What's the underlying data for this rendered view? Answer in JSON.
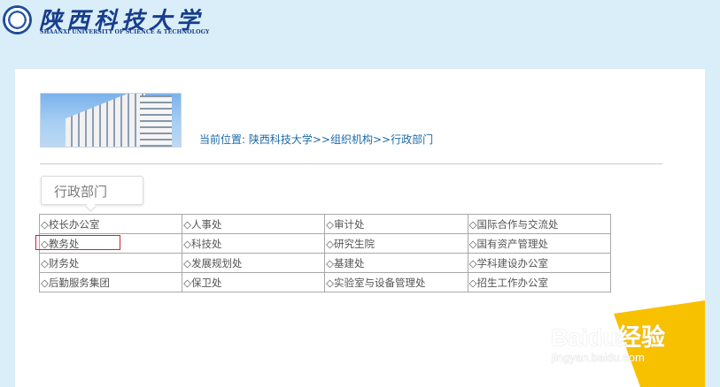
{
  "header": {
    "logo_cn": "陕西科技大学",
    "logo_en": "SHAANXI UNIVERSITY OF SCIENCE & TECHNOLOGY"
  },
  "breadcrumb": {
    "text": "当前位置: 陕西科技大学>>组织机构>>行政部门"
  },
  "tab": {
    "label": "行政部门"
  },
  "departments": [
    [
      "◇校长办公室",
      "◇人事处",
      "◇审计处",
      "◇国际合作与交流处"
    ],
    [
      "◇教务处",
      "◇科技处",
      "◇研究生院",
      "◇国有资产管理处"
    ],
    [
      "◇财务处",
      "◇发展规划处",
      "◇基建处",
      "◇学科建设办公室"
    ],
    [
      "◇后勤服务集团",
      "◇保卫处",
      "◇实验室与设备管理处",
      "◇招生工作办公室"
    ]
  ],
  "watermark": {
    "brand": "Baidu经验",
    "url": "jingyan.baidu.com"
  },
  "colors": {
    "page_bg": "#d9eef8",
    "link": "#1d6ba8",
    "highlight": "#d2232a",
    "corner": "#f8c100"
  }
}
